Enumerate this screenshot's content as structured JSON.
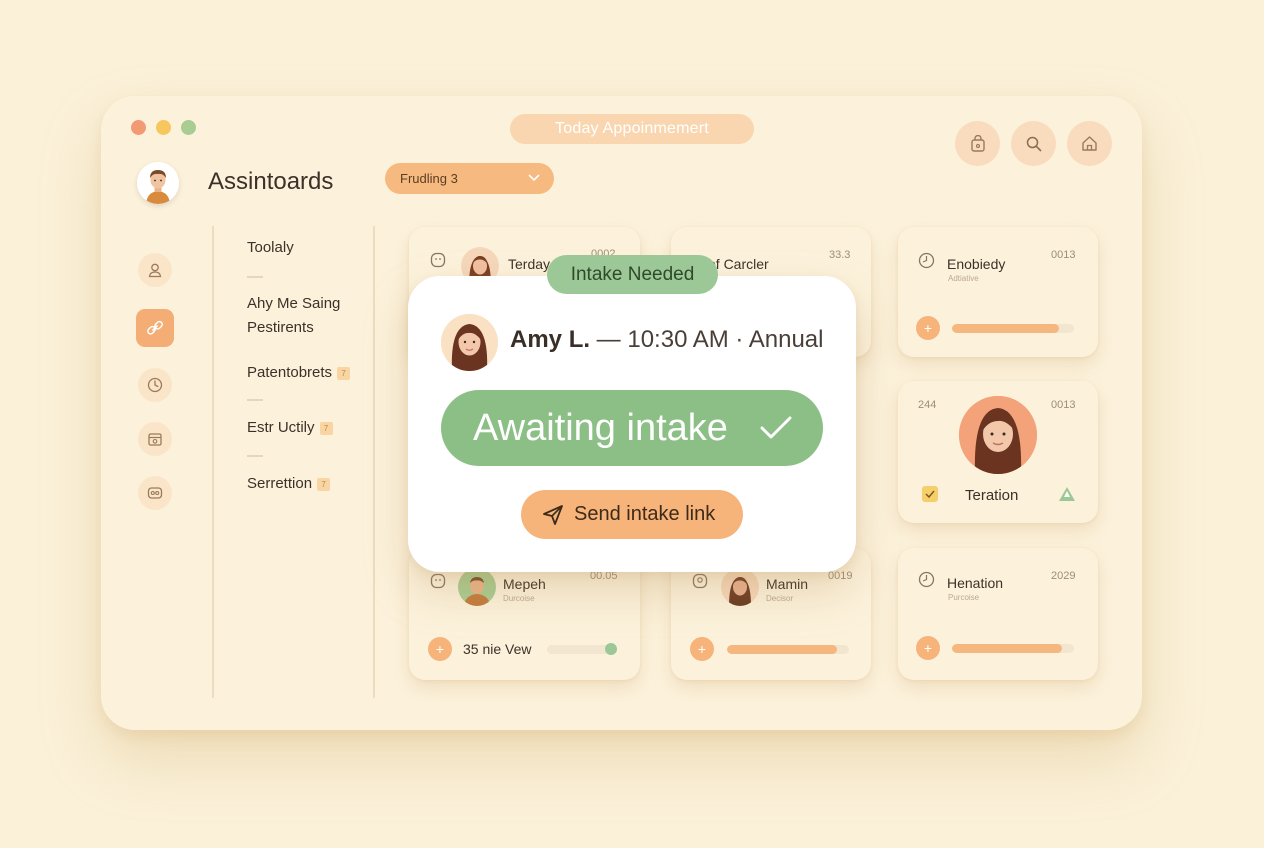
{
  "window": {
    "title": "Today Appoinmemert",
    "app_title": "Assintoards",
    "dropdown_value": "Frudling 3"
  },
  "top_icons": [
    "bag-icon",
    "search-icon",
    "home-icon"
  ],
  "sidebar_icons": [
    "person-icon",
    "link-icon",
    "clock-icon",
    "calendar-icon",
    "chat-icon"
  ],
  "nav": [
    {
      "label": "Toolaly",
      "badge": ""
    },
    {
      "label": "Ahy Me Saing",
      "badge": ""
    },
    {
      "label": "Pestirents",
      "badge": ""
    },
    {
      "label": "Patentobrets",
      "badge": "7"
    },
    {
      "label": "Estr Uctily",
      "badge": "7"
    },
    {
      "label": "Serrettion",
      "badge": "7"
    }
  ],
  "cards": {
    "c1": {
      "name": "Terday",
      "num": "0002"
    },
    "c2": {
      "name": "of Carcler",
      "num": "33.3"
    },
    "c3": {
      "name": "Enobiedy",
      "sub": "Adtiative",
      "num": "0013",
      "progress": 0.88
    },
    "c4": {
      "num_left": "244",
      "num": "0013",
      "name": "Teration"
    },
    "c5": {
      "name": "Mepeh",
      "sub": "Durcoise",
      "num": "00.05",
      "footer": "35 nie Vew",
      "progress": 0.95
    },
    "c6": {
      "name": "Mamin",
      "sub": "Decisor",
      "num": "0019",
      "progress": 0.9
    },
    "c7": {
      "name": "Henation",
      "sub": "Purcoise",
      "num": "2029",
      "progress": 0.9
    }
  },
  "modal": {
    "tag": "Intake Needed",
    "patient_name": "Amy L.",
    "details": " — 10:30 AM · Annual",
    "status": "Awaiting intake",
    "action": "Send intake link"
  },
  "colors": {
    "accent_orange": "#f6b47a",
    "accent_green": "#8cbf86",
    "background": "#fcf2dc"
  }
}
